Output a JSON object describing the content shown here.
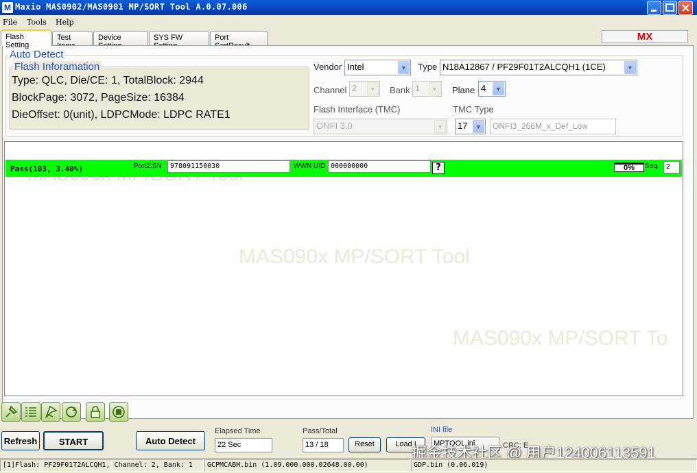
{
  "window": {
    "title": "Maxio MAS0902/MAS0901 MP/SORT Tool A.0.07.006",
    "icon_letter": "M"
  },
  "menu": {
    "items": [
      "File",
      "Tools",
      "Help"
    ]
  },
  "tabs": [
    "Flash Setting",
    "Test Items",
    "Device Setting",
    "SYS FW Setting",
    "Port SortResult"
  ],
  "brand_badge": "MX",
  "auto_detect": {
    "legend": "Auto Detect",
    "flash_info": {
      "legend": "Flash Inforamation",
      "line1": "Type: QLC, Die/CE: 1, TotalBlock: 2944",
      "line2": "BlockPage: 3072, PageSize: 16384",
      "line3": "DieOffset: 0(unit), LDPCMode: LDPC RATE1"
    },
    "vendor_label": "Vendor",
    "vendor_value": "Intel",
    "type_label": "Type",
    "type_value": "N18A12867  /  PF29F01T2ALCQH1 (1CE)",
    "channel_label": "Channel",
    "channel_value": "2",
    "bank_label": "Bank",
    "bank_value": "1",
    "plane_label": "Plane",
    "plane_value": "4",
    "flash_interface_label": "Flash Interface (TMC)",
    "flash_interface_value": "ONFI 3.0",
    "tmc_type_label": "TMC Type",
    "tmc_type_value": "17",
    "tmc_desc_value": "ONFI3_266M_x_Def_Low"
  },
  "port": {
    "status": "Pass(103, 3.40%)",
    "sn_label": "Port2:SN",
    "sn_value": "978091150030",
    "wwn_label": "WWN UID",
    "wwn_value": "000000000",
    "help": "?",
    "percent": "0%",
    "seq_label": "Seq.",
    "seq_value": "2"
  },
  "watermark": "MAS090x MP/SORT Tool",
  "watermark_cut": "MAS090x MP/SORT To",
  "toolbar_icons": [
    "pin-icon",
    "list-icon",
    "flag-icon",
    "refresh-cycle-icon",
    "lock-icon",
    "stop-icon"
  ],
  "bottom": {
    "refresh": "Refresh",
    "start": "START",
    "auto_detect": "Auto Detect",
    "elapsed_label": "Elapsed Time",
    "elapsed_value": "22 Sec",
    "pass_total_label": "Pass/Total",
    "pass_total_value": "13 / 18",
    "reset": "Reset",
    "load": "Load I",
    "ini_label": "INI file",
    "ini_value": "MPTOOL.ini",
    "crc_text": "CRC: E"
  },
  "overlay_watermark": "掘金技术社区 @ 用户124006113591",
  "status": {
    "flash": "[1]Flash: PF29F01T2ALCQH1, Channel: 2, Bank: 1",
    "fw": "GCPMCABH.bin (1.09.000.000.02648.00.00)",
    "gdp": "GDP.bin (0.06.019)"
  }
}
